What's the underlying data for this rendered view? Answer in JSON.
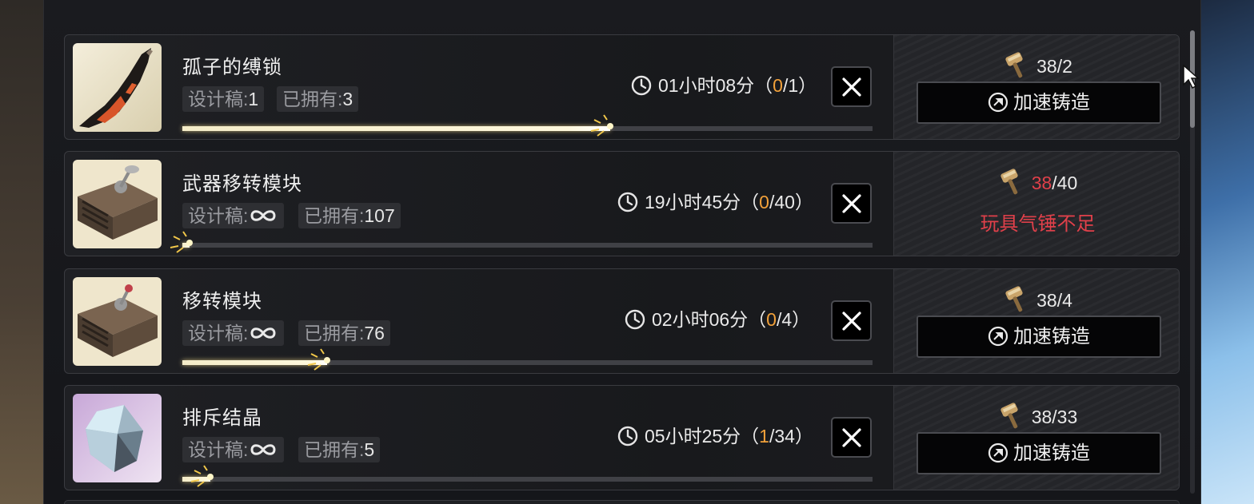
{
  "items": [
    {
      "title": "孤子的缚锁",
      "blueprint_label": "设计稿:",
      "blueprint_value": "1",
      "blueprint_infinite": false,
      "owned_label": "已拥有:",
      "owned_value": "3",
      "timer_text": "01小时08分（",
      "timer_done": "0",
      "timer_total": "/1）",
      "progress": 0.62,
      "hammer_have": "38",
      "hammer_need": "/2",
      "hammer_insufficient": false,
      "speed_label": "加速铸造",
      "image": "weapon-blade"
    },
    {
      "title": "武器移转模块",
      "blueprint_label": "设计稿:",
      "blueprint_value": "∞",
      "blueprint_infinite": true,
      "owned_label": "已拥有:",
      "owned_value": "107",
      "timer_text": "19小时45分（",
      "timer_done": "0",
      "timer_total": "/40）",
      "progress": 0.01,
      "hammer_have": "38",
      "hammer_need": "/40",
      "hammer_insufficient": true,
      "warning": "玩具气锤不足",
      "image": "module-case"
    },
    {
      "title": "移转模块",
      "blueprint_label": "设计稿:",
      "blueprint_value": "∞",
      "blueprint_infinite": true,
      "owned_label": "已拥有:",
      "owned_value": "76",
      "timer_text": "02小时06分（",
      "timer_done": "0",
      "timer_total": "/4）",
      "progress": 0.21,
      "hammer_have": "38",
      "hammer_need": "/4",
      "hammer_insufficient": false,
      "speed_label": "加速铸造",
      "image": "module-case"
    },
    {
      "title": "排斥结晶",
      "blueprint_label": "设计稿:",
      "blueprint_value": "∞",
      "blueprint_infinite": true,
      "owned_label": "已拥有:",
      "owned_value": "5",
      "timer_text": "05小时25分（",
      "timer_done": "1",
      "timer_total": "/34）",
      "progress": 0.04,
      "hammer_have": "38",
      "hammer_need": "/33",
      "hammer_insufficient": false,
      "speed_label": "加速铸造",
      "image": "crystal"
    }
  ],
  "colors": {
    "accent_orange": "#f2a13a",
    "warning_red": "#e0404a",
    "progress_fill": "#fff8dc"
  },
  "icons": [
    "clock-icon",
    "close-icon",
    "hammer-icon",
    "speedup-icon",
    "infinity-icon",
    "cursor-icon"
  ]
}
